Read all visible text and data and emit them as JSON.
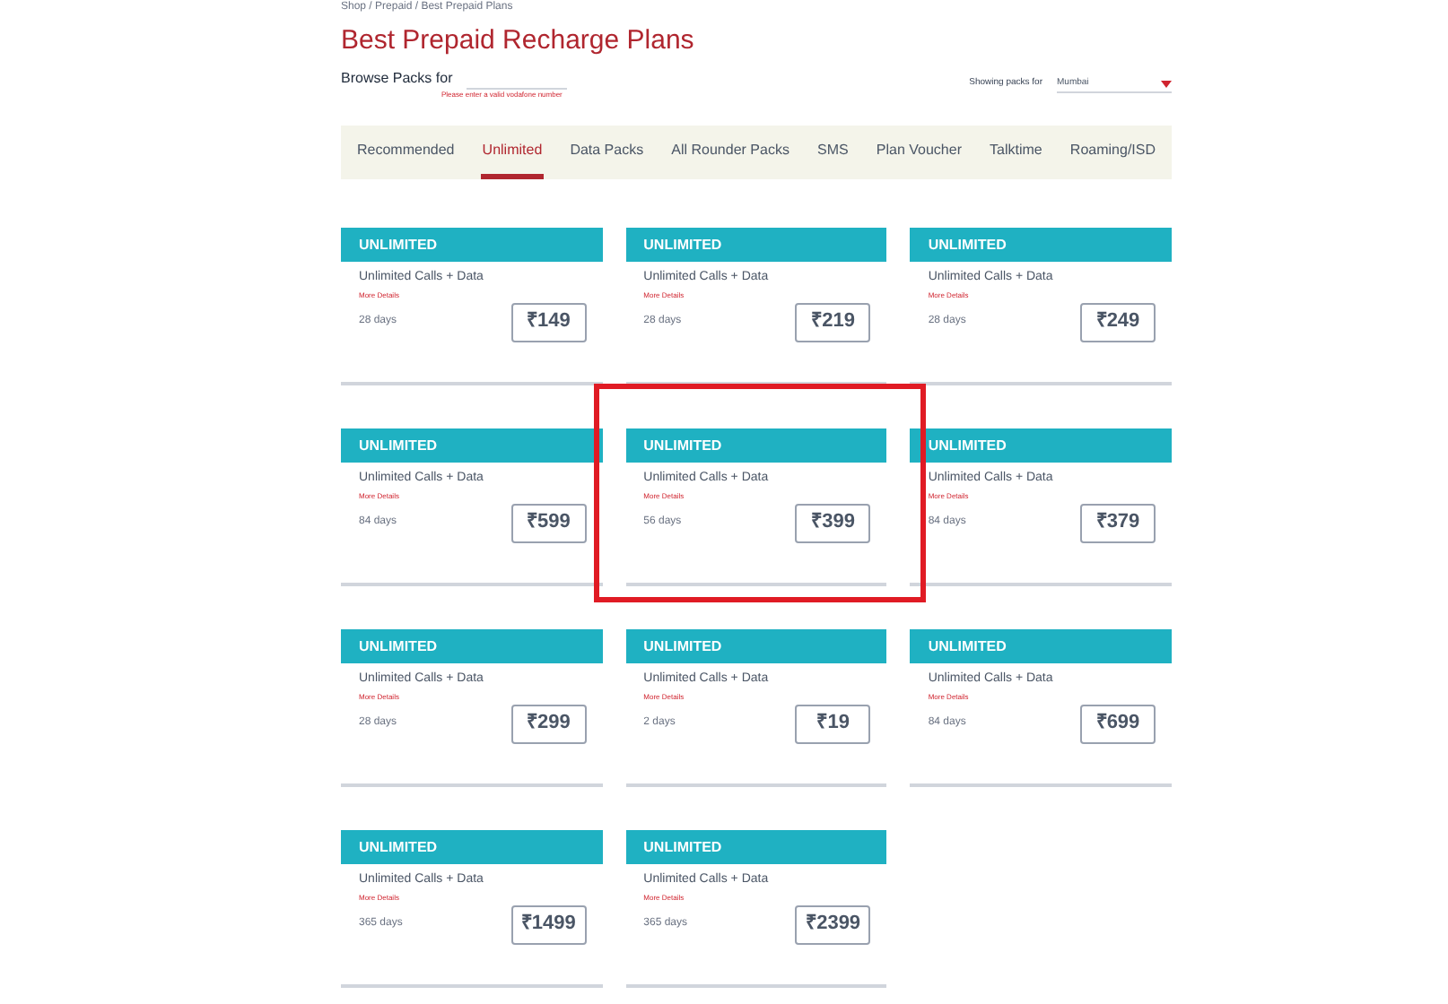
{
  "breadcrumb": "Shop / Prepaid / Best Prepaid Plans",
  "title": "Best Prepaid Recharge Plans",
  "browse": {
    "label": "Browse Packs for",
    "error": "Please enter a valid vodafone number"
  },
  "location": {
    "label": "Showing packs for",
    "value": "Mumbai"
  },
  "tabs": [
    {
      "label": "Recommended",
      "selected": false
    },
    {
      "label": "Unlimited",
      "selected": true
    },
    {
      "label": "Data Packs",
      "selected": false
    },
    {
      "label": "All Rounder Packs",
      "selected": false
    },
    {
      "label": "SMS",
      "selected": false
    },
    {
      "label": "Plan Voucher",
      "selected": false
    },
    {
      "label": "Talktime",
      "selected": false
    },
    {
      "label": "Roaming/ISD",
      "selected": false
    }
  ],
  "plans": [
    {
      "category": "UNLIMITED",
      "benefit": "Unlimited Calls + Data",
      "link": "More Details",
      "validity": "28 days",
      "price": "₹149",
      "highlighted": false
    },
    {
      "category": "UNLIMITED",
      "benefit": "Unlimited Calls + Data",
      "link": "More Details",
      "validity": "28 days",
      "price": "₹219",
      "highlighted": false
    },
    {
      "category": "UNLIMITED",
      "benefit": "Unlimited Calls + Data",
      "link": "More Details",
      "validity": "28 days",
      "price": "₹249",
      "highlighted": false
    },
    {
      "category": "UNLIMITED",
      "benefit": "Unlimited Calls + Data",
      "link": "More Details",
      "validity": "84 days",
      "price": "₹599",
      "highlighted": false
    },
    {
      "category": "UNLIMITED",
      "benefit": "Unlimited Calls + Data",
      "link": "More Details",
      "validity": "56 days",
      "price": "₹399",
      "highlighted": true
    },
    {
      "category": "UNLIMITED",
      "benefit": "Unlimited Calls + Data",
      "link": "More Details",
      "validity": "84 days",
      "price": "₹379",
      "highlighted": false
    },
    {
      "category": "UNLIMITED",
      "benefit": "Unlimited Calls + Data",
      "link": "More Details",
      "validity": "28 days",
      "price": "₹299",
      "highlighted": false
    },
    {
      "category": "UNLIMITED",
      "benefit": "Unlimited Calls + Data",
      "link": "More Details",
      "validity": "2 days",
      "price": "₹19",
      "highlighted": false
    },
    {
      "category": "UNLIMITED",
      "benefit": "Unlimited Calls + Data",
      "link": "More Details",
      "validity": "84 days",
      "price": "₹699",
      "highlighted": false
    },
    {
      "category": "UNLIMITED",
      "benefit": "Unlimited Calls + Data",
      "link": "More Details",
      "validity": "365 days",
      "price": "₹1499",
      "highlighted": false
    },
    {
      "category": "UNLIMITED",
      "benefit": "Unlimited Calls + Data",
      "link": "More Details",
      "validity": "365 days",
      "price": "₹2399",
      "highlighted": false
    }
  ]
}
